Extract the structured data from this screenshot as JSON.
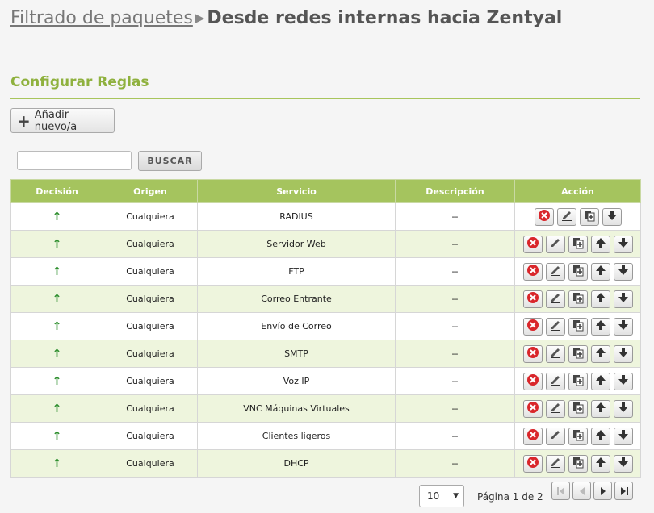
{
  "header": {
    "breadcrumb_parent": "Filtrado de paquetes",
    "breadcrumb_separator": "▶",
    "title": "Desde redes internas hacia Zentyal"
  },
  "section": {
    "title": "Configurar Reglas"
  },
  "toolbar": {
    "add_label": "Añadir nuevo/a",
    "search_placeholder": "",
    "search_label": "BUSCAR"
  },
  "table": {
    "columns": [
      "Decisión",
      "Origen",
      "Servicio",
      "Descripción",
      "Acción"
    ],
    "rows": [
      {
        "decision": "↑",
        "origin": "Cualquiera",
        "service": "RADIUS",
        "description": "--"
      },
      {
        "decision": "↑",
        "origin": "Cualquiera",
        "service": "Servidor Web",
        "description": "--"
      },
      {
        "decision": "↑",
        "origin": "Cualquiera",
        "service": "FTP",
        "description": "--"
      },
      {
        "decision": "↑",
        "origin": "Cualquiera",
        "service": "Correo Entrante",
        "description": "--"
      },
      {
        "decision": "↑",
        "origin": "Cualquiera",
        "service": "Envío de Correo",
        "description": "--"
      },
      {
        "decision": "↑",
        "origin": "Cualquiera",
        "service": "SMTP",
        "description": "--"
      },
      {
        "decision": "↑",
        "origin": "Cualquiera",
        "service": "Voz IP",
        "description": "--"
      },
      {
        "decision": "↑",
        "origin": "Cualquiera",
        "service": "VNC Máquinas Virtuales",
        "description": "--"
      },
      {
        "decision": "↑",
        "origin": "Cualquiera",
        "service": "Clientes ligeros",
        "description": "--"
      },
      {
        "decision": "↑",
        "origin": "Cualquiera",
        "service": "DHCP",
        "description": "--"
      }
    ],
    "row_actions": [
      "delete-icon",
      "edit-icon",
      "clone-icon",
      "move-up-icon",
      "move-down-icon"
    ]
  },
  "pagination": {
    "page_size": "10",
    "page_label": "Página 1 de 2",
    "buttons": [
      "first-page-icon",
      "previous-page-icon",
      "next-page-icon",
      "last-page-icon"
    ]
  },
  "colors": {
    "accent": "#a5c45e",
    "section_title": "#8fb13e",
    "row_alt": "#eef5dd",
    "delete_red": "#d9262b",
    "decision_green": "#2f8f2f"
  }
}
